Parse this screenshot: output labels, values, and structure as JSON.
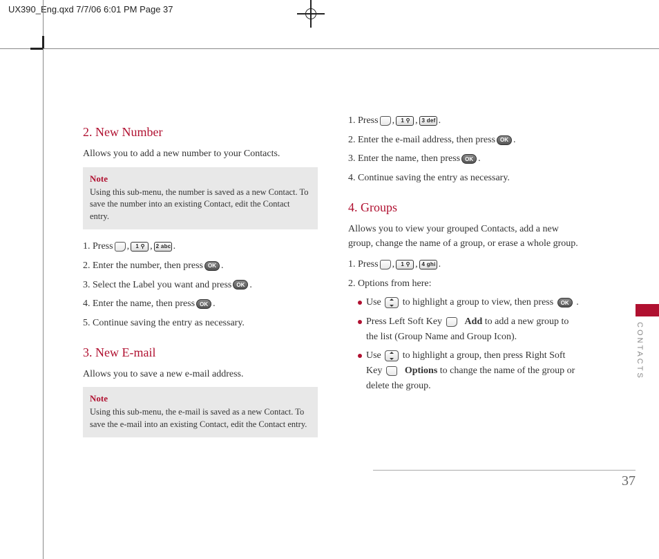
{
  "crop_header": "UX390_Eng.qxd  7/7/06  6:01 PM  Page 37",
  "side_label": "CONTACTS",
  "page_number": "37",
  "keys": {
    "k1": "1 ⚲",
    "k2": "2 abc",
    "k3": "3 def",
    "k4": "4 ghi",
    "ok": "OK"
  },
  "sec2": {
    "title": "2. New Number",
    "intro": "Allows you to add a new number to your Contacts.",
    "note_title": "Note",
    "note_body": "Using this sub-menu, the number is saved as a new Contact. To save the number into an existing Contact, edit the Contact entry.",
    "s1a": "1. Press ",
    "s1b": ", ",
    "s1c": ", ",
    "s1d": ".",
    "s2a": "2. Enter the number, then press ",
    "s2b": ".",
    "s3a": "3. Select the Label you want and press ",
    "s3b": ".",
    "s4a": "4. Enter the name, then press ",
    "s4b": ".",
    "s5": "5. Continue saving the entry as necessary."
  },
  "sec3": {
    "title": "3. New E-mail",
    "intro": "Allows you to save a new e-mail address.",
    "note_title": "Note",
    "note_body": "Using this sub-menu, the e-mail is saved as a new Contact. To save the e-mail into an existing Contact, edit the Contact entry.",
    "s1a": "1. Press ",
    "s1b": ", ",
    "s1c": ", ",
    "s1d": ".",
    "s2a": "2. Enter the e-mail address, then press ",
    "s2b": ".",
    "s3a": "3. Enter the name, then press ",
    "s3b": ".",
    "s4": "4. Continue saving the entry as necessary."
  },
  "sec4": {
    "title": "4. Groups",
    "intro": "Allows you to view your grouped Contacts, add a new group, change the name of a group, or erase a whole group.",
    "s1a": "1. Press ",
    "s1b": ", ",
    "s1c": ", ",
    "s1d": ".",
    "s2": "2. Options from here:",
    "b1a": "Use ",
    "b1b": " to highlight a group to view, then press ",
    "b1c": ".",
    "b2a": "Press Left Soft Key ",
    "b2add": "Add",
    "b2b": " to add a new group to the list (Group Name and Group Icon).",
    "b3a": "Use ",
    "b3b": " to highlight a group, then press Right Soft Key ",
    "b3opt": "Options",
    "b3c": " to change the name of the group or delete the group."
  }
}
